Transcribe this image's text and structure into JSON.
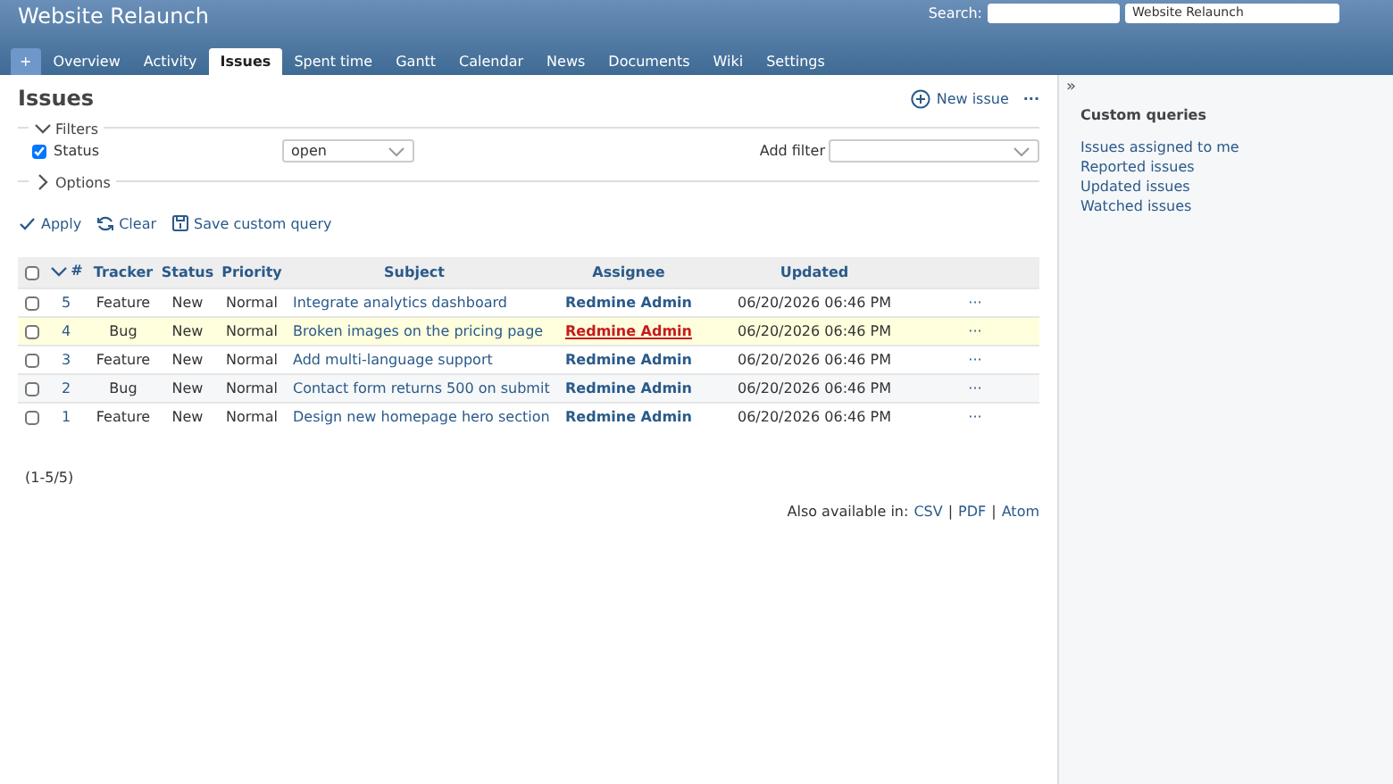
{
  "header": {
    "title": "Website Relaunch",
    "search_label": "Search:",
    "project_jump": {
      "value": "Website Relaunch"
    }
  },
  "tabs": [
    {
      "label": "+",
      "kind": "new",
      "selected": false
    },
    {
      "label": "Overview",
      "kind": "tab",
      "selected": false
    },
    {
      "label": "Activity",
      "kind": "tab",
      "selected": false
    },
    {
      "label": "Issues",
      "kind": "tab",
      "selected": true
    },
    {
      "label": "Spent time",
      "kind": "tab",
      "selected": false
    },
    {
      "label": "Gantt",
      "kind": "tab",
      "selected": false
    },
    {
      "label": "Calendar",
      "kind": "tab",
      "selected": false
    },
    {
      "label": "News",
      "kind": "tab",
      "selected": false
    },
    {
      "label": "Documents",
      "kind": "tab",
      "selected": false
    },
    {
      "label": "Wiki",
      "kind": "tab",
      "selected": false
    },
    {
      "label": "Settings",
      "kind": "tab",
      "selected": false
    }
  ],
  "page": {
    "title": "Issues",
    "new_issue": "New issue",
    "more": "···"
  },
  "filters": {
    "legend": "Filters",
    "expanded": true,
    "status": {
      "label": "Status",
      "checked": true,
      "value": "open"
    },
    "add_filter": "Add filter"
  },
  "options": {
    "legend": "Options",
    "expanded": false
  },
  "actions": [
    "Apply",
    "Clear",
    "Save custom query"
  ],
  "table": {
    "columns": [
      "#",
      "Tracker",
      "Status",
      "Priority",
      "Subject",
      "Assignee",
      "Updated"
    ],
    "rows": [
      {
        "id": "5",
        "tracker": "Feature",
        "status": "New",
        "priority": "Normal",
        "subject": "Integrate analytics dashboard",
        "assignee": "Redmine Admin",
        "updated": "06/20/2026 06:46 PM",
        "hovered": false,
        "checked": false
      },
      {
        "id": "4",
        "tracker": "Bug",
        "status": "New",
        "priority": "Normal",
        "subject": "Broken images on the pricing page",
        "assignee": "Redmine Admin",
        "updated": "06/20/2026 06:46 PM",
        "hovered": true,
        "checked": false
      },
      {
        "id": "3",
        "tracker": "Feature",
        "status": "New",
        "priority": "Normal",
        "subject": "Add multi-language support",
        "assignee": "Redmine Admin",
        "updated": "06/20/2026 06:46 PM",
        "hovered": false,
        "checked": false
      },
      {
        "id": "2",
        "tracker": "Bug",
        "status": "New",
        "priority": "Normal",
        "subject": "Contact form returns 500 on submit",
        "assignee": "Redmine Admin",
        "updated": "06/20/2026 06:46 PM",
        "hovered": false,
        "checked": false
      },
      {
        "id": "1",
        "tracker": "Feature",
        "status": "New",
        "priority": "Normal",
        "subject": "Design new homepage hero section",
        "assignee": "Redmine Admin",
        "updated": "06/20/2026 06:46 PM",
        "hovered": false,
        "checked": false
      }
    ],
    "row_menu": "···",
    "select_all": {
      "checked": false
    }
  },
  "pagination": "(1-5/5)",
  "export": {
    "label": "Also available in:",
    "formats": [
      "CSV",
      "PDF",
      "Atom"
    ],
    "separator": "|"
  },
  "sidebar": {
    "toggle": "»",
    "title": "Custom queries",
    "items": [
      "Issues assigned to me",
      "Reported issues",
      "Updated issues",
      "Watched issues"
    ]
  }
}
